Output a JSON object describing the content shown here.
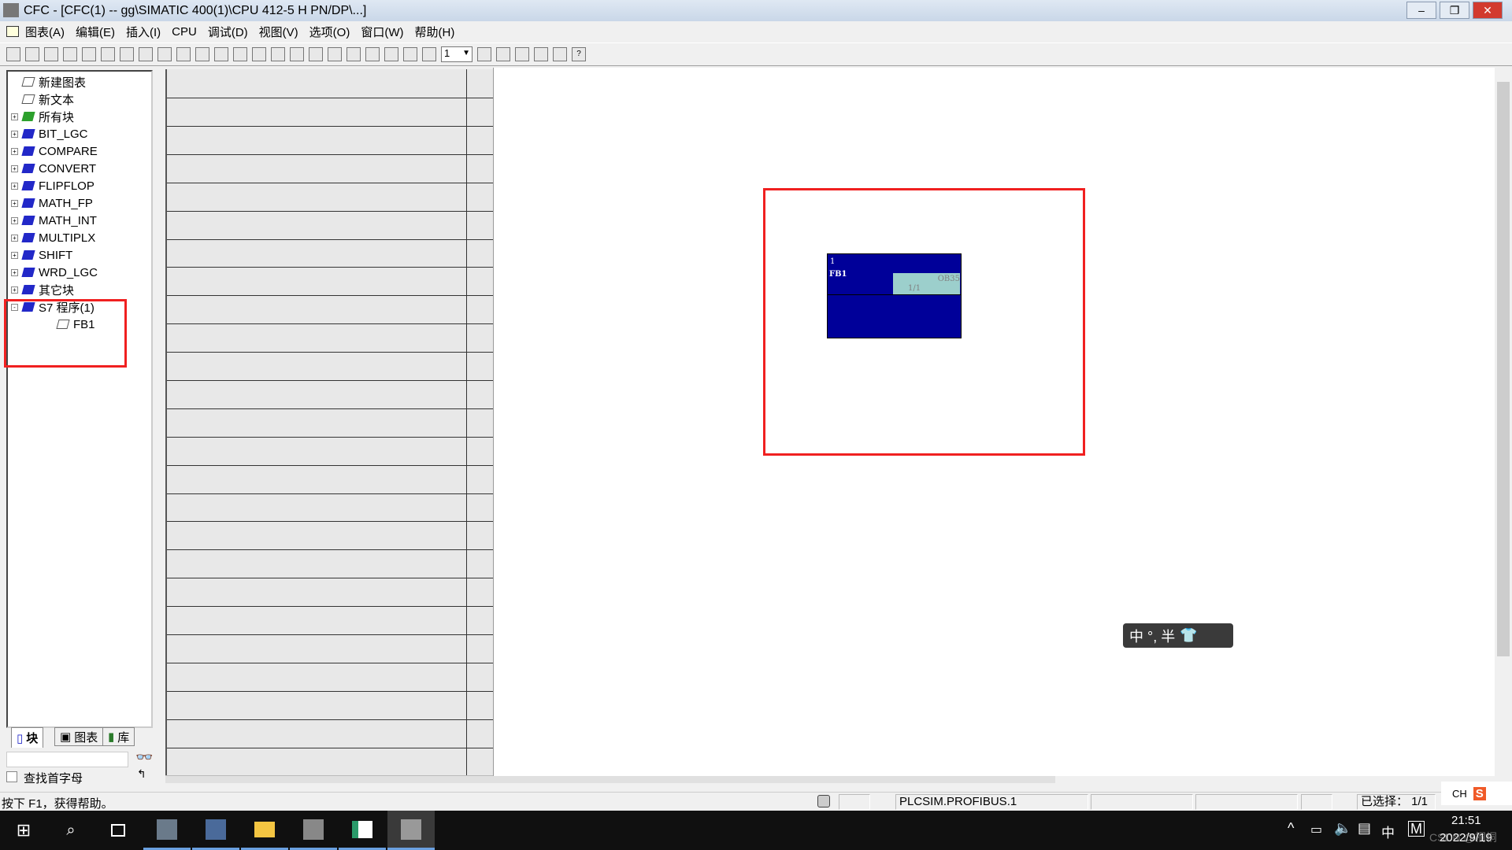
{
  "window": {
    "title": "CFC - [CFC(1) -- gg\\SIMATIC 400(1)\\CPU 412-5 H PN/DP\\...]",
    "minimize": "–",
    "restore": "❐",
    "close": "✕"
  },
  "menu": [
    "图表(A)",
    "编辑(E)",
    "插入(I)",
    "CPU",
    "调试(D)",
    "视图(V)",
    "选项(O)",
    "窗口(W)",
    "帮助(H)"
  ],
  "toolbar": {
    "sheet_select": "1"
  },
  "tree": [
    {
      "label": "新建图表",
      "icon": "new-chart-icon",
      "expand": ""
    },
    {
      "label": "新文本",
      "icon": "new-text-icon",
      "expand": ""
    },
    {
      "label": "所有块",
      "icon": "all-blocks-icon",
      "expand": "+"
    },
    {
      "label": "BIT_LGC",
      "icon": "block-folder-icon",
      "expand": "+"
    },
    {
      "label": "COMPARE",
      "icon": "block-folder-icon",
      "expand": "+"
    },
    {
      "label": "CONVERT",
      "icon": "block-folder-icon",
      "expand": "+"
    },
    {
      "label": "FLIPFLOP",
      "icon": "block-folder-icon",
      "expand": "+"
    },
    {
      "label": "MATH_FP",
      "icon": "block-folder-icon",
      "expand": "+"
    },
    {
      "label": "MATH_INT",
      "icon": "block-folder-icon",
      "expand": "+"
    },
    {
      "label": "MULTIPLX",
      "icon": "block-folder-icon",
      "expand": "+"
    },
    {
      "label": "SHIFT",
      "icon": "block-folder-icon",
      "expand": "+"
    },
    {
      "label": "WRD_LGC",
      "icon": "block-folder-icon",
      "expand": "+"
    },
    {
      "label": "其它块",
      "icon": "block-folder-icon",
      "expand": "+"
    },
    {
      "label": "S7 程序(1)",
      "icon": "s7-program-icon",
      "expand": "-"
    },
    {
      "label": "FB1",
      "icon": "function-block-icon",
      "expand": ""
    }
  ],
  "tabs": [
    "块",
    "图表",
    "库"
  ],
  "search": {
    "value": "",
    "checkbox_label": "查找首字母"
  },
  "block": {
    "number": "1",
    "name": "FB1",
    "task": "OB35",
    "sequence": "1/1",
    "color": "#000099",
    "task_color": "#9ccfcc"
  },
  "ime": {
    "label": "中 °, 半"
  },
  "status": {
    "help": "按下 F1，获得帮助。",
    "connection": "PLCSIM.PROFIBUS.1",
    "selected": "已选择： 1/1"
  },
  "ime_tray": {
    "lang": "CH"
  },
  "taskbar": {
    "time": "21:51",
    "date": "2022/9/19",
    "ime_lang": "中",
    "ime_mode": "M",
    "watermark": "CSDN @桐桐"
  },
  "accent": "#f02020"
}
